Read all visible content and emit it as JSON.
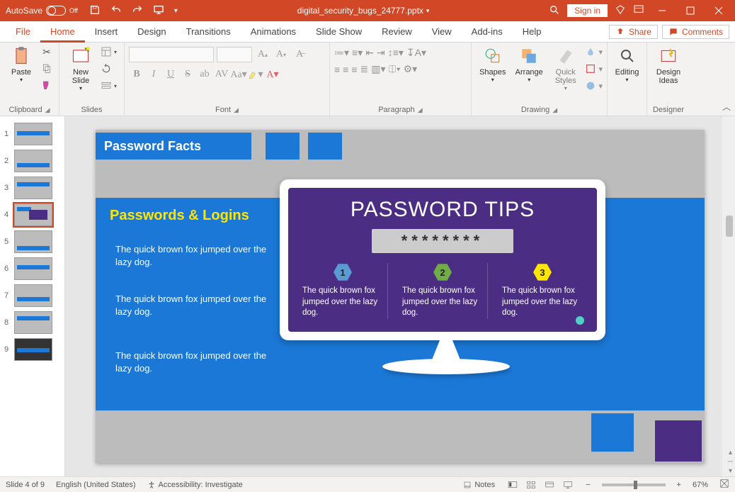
{
  "titlebar": {
    "autosave_label": "AutoSave",
    "autosave_state": "Off",
    "filename": "digital_security_bugs_24777.pptx",
    "signin": "Sign in"
  },
  "tabs": {
    "file": "File",
    "home": "Home",
    "insert": "Insert",
    "design": "Design",
    "transitions": "Transitions",
    "animations": "Animations",
    "slideshow": "Slide Show",
    "review": "Review",
    "view": "View",
    "addins": "Add-ins",
    "help": "Help",
    "share": "Share",
    "comments": "Comments"
  },
  "ribbon": {
    "clipboard": {
      "paste": "Paste",
      "label": "Clipboard"
    },
    "slides": {
      "newslide": "New\nSlide",
      "label": "Slides"
    },
    "font": {
      "label": "Font"
    },
    "paragraph": {
      "label": "Paragraph"
    },
    "drawing": {
      "shapes": "Shapes",
      "arrange": "Arrange",
      "quick": "Quick\nStyles",
      "label": "Drawing"
    },
    "editing": {
      "label": "Editing"
    },
    "designer": {
      "btn": "Design\nIdeas",
      "label": "Designer"
    }
  },
  "thumbs": {
    "count": 9,
    "selected": 4
  },
  "slide": {
    "titleband": "Password Facts",
    "subtitle": "Passwords & Logins",
    "paras": [
      "The quick brown fox jumped over the lazy dog.",
      "The quick brown fox jumped over the lazy dog.",
      "The quick brown fox jumped over the lazy dog."
    ],
    "screen_title": "PASSWORD TIPS",
    "pwmask": "********",
    "tips": [
      {
        "n": "1",
        "text": "The quick brown fox jumped over the lazy dog.",
        "color": "#5a9bd5"
      },
      {
        "n": "2",
        "text": "The quick brown fox jumped over the lazy dog.",
        "color": "#70ad47"
      },
      {
        "n": "3",
        "text": "The quick brown fox jumped over the lazy dog.",
        "color": "#ffe600"
      }
    ]
  },
  "status": {
    "slidecount": "Slide 4 of 9",
    "lang": "English (United States)",
    "access": "Accessibility: Investigate",
    "notes": "Notes",
    "zoom": "67%"
  }
}
